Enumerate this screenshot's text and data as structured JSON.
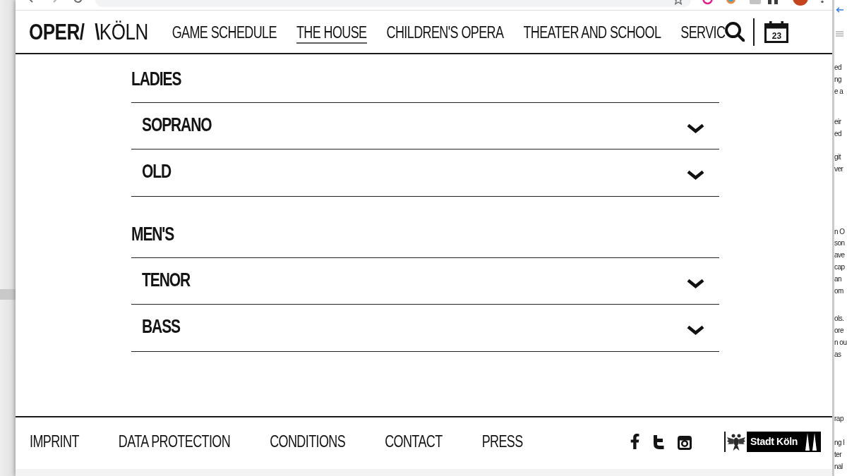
{
  "header": {
    "logo": {
      "bold_part": "OPER/ \\",
      "light_part": "KÖLN"
    },
    "nav_items": [
      {
        "label": "GAME SCHEDULE",
        "selected": false
      },
      {
        "label": "THE HOUSE",
        "selected": true
      },
      {
        "label": "CHILDREN'S OPERA",
        "selected": false
      },
      {
        "label": "THEATER AND SCHOOL",
        "selected": false
      },
      {
        "label": "SERVIC",
        "selected": false
      }
    ],
    "calendar_day": "23"
  },
  "voice_groups": [
    {
      "title": "LADIES",
      "sections": [
        {
          "label": "SOPRANO",
          "expanded": false
        },
        {
          "label": "OLD",
          "expanded": false
        }
      ]
    },
    {
      "title": "MEN'S",
      "sections": [
        {
          "label": "TENOR",
          "expanded": false
        },
        {
          "label": "BASS",
          "expanded": false
        }
      ]
    }
  ],
  "footer": {
    "links": [
      "IMPRINT",
      "DATA PROTECTION",
      "CONDITIONS",
      "CONTACT",
      "PRESS"
    ],
    "city_logo": "Stadt Köln"
  },
  "background_window": {
    "paragraphs": [
      [
        "ed",
        "ng",
        "e a"
      ],
      [
        "eir",
        "ed"
      ],
      [
        "git",
        "ver"
      ],
      [
        "n O",
        "son",
        "ave",
        "cap",
        "an",
        "om"
      ],
      [
        "ols.",
        "ore",
        "n ou",
        "as"
      ],
      [
        "rap"
      ],
      [
        "ng l",
        "ter",
        "nal"
      ]
    ]
  }
}
